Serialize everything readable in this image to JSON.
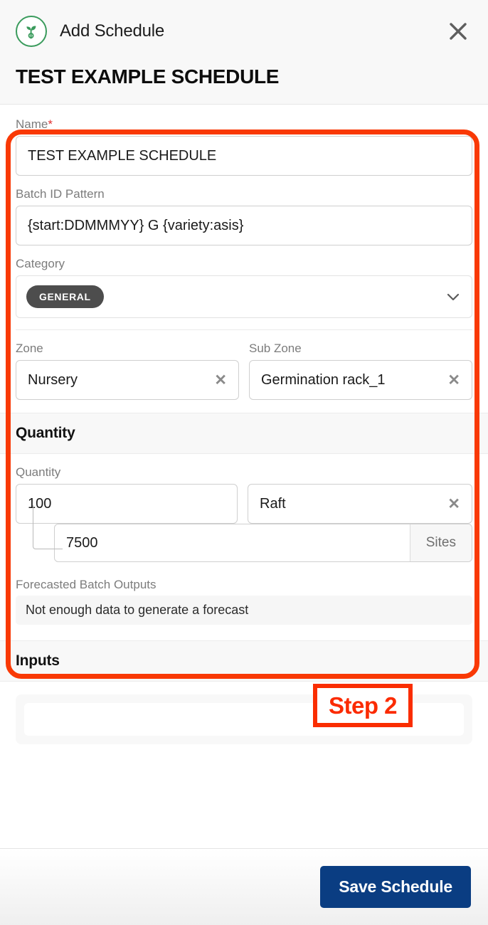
{
  "header": {
    "brand_icon": "seedling-icon",
    "title": "Add Schedule",
    "close_icon": "close-icon",
    "schedule_name": "TEST EXAMPLE SCHEDULE"
  },
  "form": {
    "name": {
      "label": "Name",
      "required_mark": "*",
      "value": "TEST EXAMPLE SCHEDULE"
    },
    "batch_id_pattern": {
      "label": "Batch ID Pattern",
      "value": "{start:DDMMMYY} G {variety:asis}"
    },
    "category": {
      "label": "Category",
      "selected": "GENERAL",
      "chevron_icon": "chevron-down-icon"
    },
    "zone": {
      "label": "Zone",
      "value": "Nursery",
      "clear_icon": "clear-x-icon",
      "clear_label": "✕"
    },
    "sub_zone": {
      "label": "Sub Zone",
      "value": "Germination rack_1",
      "clear_icon": "clear-x-icon",
      "clear_label": "✕"
    }
  },
  "quantity_section": {
    "heading": "Quantity",
    "quantity": {
      "label": "Quantity",
      "value": "100"
    },
    "unit": {
      "value": "Raft",
      "clear_label": "✕"
    },
    "sites": {
      "value": "7500",
      "suffix": "Sites"
    }
  },
  "forecast": {
    "label": "Forecasted Batch Outputs",
    "message": "Not enough data to generate a forecast"
  },
  "inputs_section": {
    "heading": "Inputs"
  },
  "footer": {
    "save_label": "Save Schedule"
  },
  "annotations": {
    "step_label": "Step 2",
    "highlight_color": "#f93905",
    "step_color": "#fb2b00"
  },
  "colors": {
    "brand_green": "#3a9b5c",
    "primary_blue": "#0a3d82",
    "chip_gray": "#4d4d4d",
    "label_gray": "#7c7c7c",
    "required_red": "#e03131"
  }
}
